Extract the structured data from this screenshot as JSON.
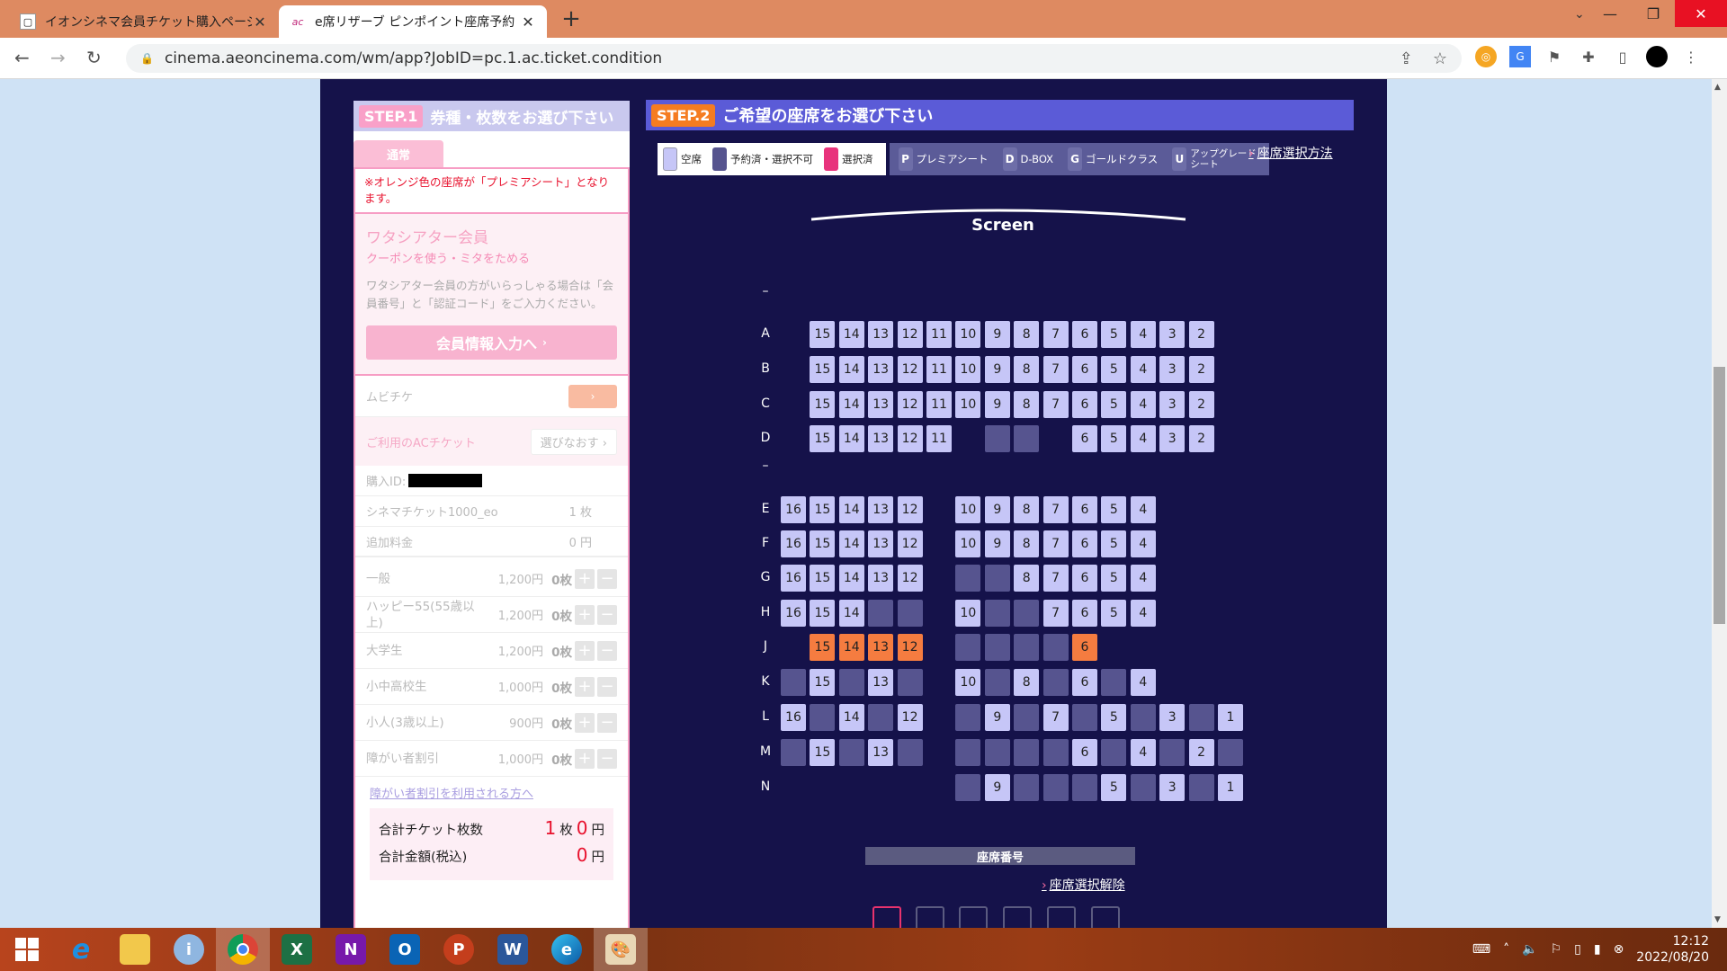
{
  "browser": {
    "tabs": [
      {
        "title": "イオンシネマ会員チケット購入ページ"
      },
      {
        "title": "e席リザーブ ピンポイント座席予約"
      }
    ],
    "url": "cinema.aeoncinema.com/wm/app?JobID=pc.1.ac.ticket.condition"
  },
  "left": {
    "step_badge": "STEP.1",
    "step_title": "券種・枚数をお選び下さい",
    "tab_label": "通常",
    "note": "※オレンジ色の座席が「プレミアシート」となります。",
    "member_title": "ワタシアター会員",
    "member_sub": "クーポンを使う・ミタをためる",
    "member_text": "ワタシアター会員の方がいらっしゃる場合は「会員番号」と「認証コード」をご入力ください。",
    "member_button": "会員情報入力へ",
    "mubichike_label": "ムビチケ",
    "ac_label": "ご利用のACチケット",
    "ac_button": "選びなおす",
    "purchase_id_label": "購入ID:",
    "cinema_ticket_label": "シネマチケット1000_eo",
    "cinema_ticket_count": "1 枚",
    "extra_fee_label": "追加料金",
    "extra_fee_value": "0 円",
    "ticket_types": [
      {
        "name": "一般",
        "price": "1,200円",
        "count": "0枚"
      },
      {
        "name": "ハッピー55(55歳以上)",
        "price": "1,200円",
        "count": "0枚"
      },
      {
        "name": "大学生",
        "price": "1,200円",
        "count": "0枚"
      },
      {
        "name": "小中高校生",
        "price": "1,000円",
        "count": "0枚"
      },
      {
        "name": "小人(3歳以上)",
        "price": "900円",
        "count": "0枚"
      },
      {
        "name": "障がい者割引",
        "price": "1,000円",
        "count": "0枚"
      }
    ],
    "disability_link": "障がい者割引を利用される方へ",
    "total_tickets_label": "合計チケット枚数",
    "total_tickets_value": "1",
    "total_tickets_unit": "枚",
    "total_tickets_yen": "0",
    "total_amount_label": "合計金額(税込)",
    "total_amount_value": "0",
    "yen": "円"
  },
  "right": {
    "step_badge": "STEP.2",
    "step_title": "ご希望の座席をお選び下さい",
    "legend": {
      "available": "空席",
      "taken": "予約済・選択不可",
      "selected": "選択済",
      "premier_letter": "P",
      "premier": "プレミアシート",
      "dbox_letter": "D",
      "dbox": "D-BOX",
      "gold_letter": "G",
      "gold": "ゴールドクラス",
      "upgrade_letter": "U",
      "upgrade": "アップグレードシート"
    },
    "howto_link": "座席選択方法",
    "screen_label": "Screen",
    "seat_number_label": "座席番号",
    "cancel_link": "座席選択解除"
  },
  "seatmap": {
    "rows": [
      {
        "label": "–",
        "seats": []
      },
      {
        "label": "A",
        "seats": [
          [
            "15",
            "a"
          ],
          [
            "14",
            "a"
          ],
          [
            "13",
            "a"
          ],
          [
            "12",
            "a"
          ],
          [
            "11",
            "a"
          ],
          [
            "10",
            "a"
          ],
          [
            "9",
            "a"
          ],
          [
            "8",
            "a"
          ],
          [
            "7",
            "a"
          ],
          [
            "6",
            "a"
          ],
          [
            "5",
            "a"
          ],
          [
            "4",
            "a"
          ],
          [
            "3",
            "a"
          ],
          [
            "2",
            "a"
          ]
        ]
      },
      {
        "label": "B",
        "seats": [
          [
            "15",
            "a"
          ],
          [
            "14",
            "a"
          ],
          [
            "13",
            "a"
          ],
          [
            "12",
            "a"
          ],
          [
            "11",
            "a"
          ],
          [
            "10",
            "a"
          ],
          [
            "9",
            "a"
          ],
          [
            "8",
            "a"
          ],
          [
            "7",
            "a"
          ],
          [
            "6",
            "a"
          ],
          [
            "5",
            "a"
          ],
          [
            "4",
            "a"
          ],
          [
            "3",
            "a"
          ],
          [
            "2",
            "a"
          ]
        ]
      },
      {
        "label": "C",
        "seats": [
          [
            "15",
            "a"
          ],
          [
            "14",
            "a"
          ],
          [
            "13",
            "a"
          ],
          [
            "12",
            "a"
          ],
          [
            "11",
            "a"
          ],
          [
            "10",
            "a"
          ],
          [
            "9",
            "a"
          ],
          [
            "8",
            "a"
          ],
          [
            "7",
            "a"
          ],
          [
            "6",
            "a"
          ],
          [
            "5",
            "a"
          ],
          [
            "4",
            "a"
          ],
          [
            "3",
            "a"
          ],
          [
            "2",
            "a"
          ]
        ]
      },
      {
        "label": "D",
        "seats": [
          [
            "15",
            "a"
          ],
          [
            "14",
            "a"
          ],
          [
            "13",
            "a"
          ],
          [
            "12",
            "a"
          ],
          [
            "11",
            "a"
          ],
          null,
          [
            "",
            "t"
          ],
          [
            "",
            "t"
          ],
          null,
          [
            "6",
            "a"
          ],
          [
            "5",
            "a"
          ],
          [
            "4",
            "a"
          ],
          [
            "3",
            "a"
          ],
          [
            "2",
            "a"
          ]
        ]
      },
      {
        "label": "–",
        "seats": []
      },
      {
        "label": "E",
        "seats": [
          [
            "16",
            "a"
          ],
          [
            "15",
            "a"
          ],
          [
            "14",
            "a"
          ],
          [
            "13",
            "a"
          ],
          [
            "12",
            "a"
          ],
          null,
          [
            "10",
            "a"
          ],
          [
            "9",
            "a"
          ],
          [
            "8",
            "a"
          ],
          [
            "7",
            "a"
          ],
          [
            "6",
            "a"
          ],
          [
            "5",
            "a"
          ],
          [
            "4",
            "a"
          ]
        ]
      },
      {
        "label": "F",
        "seats": [
          [
            "16",
            "a"
          ],
          [
            "15",
            "a"
          ],
          [
            "14",
            "a"
          ],
          [
            "13",
            "a"
          ],
          [
            "12",
            "a"
          ],
          null,
          [
            "10",
            "a"
          ],
          [
            "9",
            "a"
          ],
          [
            "8",
            "a"
          ],
          [
            "7",
            "a"
          ],
          [
            "6",
            "a"
          ],
          [
            "5",
            "a"
          ],
          [
            "4",
            "a"
          ]
        ]
      },
      {
        "label": "G",
        "seats": [
          [
            "16",
            "a"
          ],
          [
            "15",
            "a"
          ],
          [
            "14",
            "a"
          ],
          [
            "13",
            "a"
          ],
          [
            "12",
            "a"
          ],
          null,
          [
            "",
            "t"
          ],
          [
            "",
            "t"
          ],
          [
            "8",
            "a"
          ],
          [
            "7",
            "a"
          ],
          [
            "6",
            "a"
          ],
          [
            "5",
            "a"
          ],
          [
            "4",
            "a"
          ]
        ]
      },
      {
        "label": "H",
        "seats": [
          [
            "16",
            "a"
          ],
          [
            "15",
            "a"
          ],
          [
            "14",
            "a"
          ],
          [
            "",
            "t"
          ],
          [
            "",
            "t"
          ],
          null,
          [
            "10",
            "a"
          ],
          [
            "",
            "t"
          ],
          [
            "",
            "t"
          ],
          [
            "7",
            "a"
          ],
          [
            "6",
            "a"
          ],
          [
            "5",
            "a"
          ],
          [
            "4",
            "a"
          ]
        ]
      },
      {
        "label": "J",
        "seats": [
          null,
          [
            "15",
            "p"
          ],
          [
            "14",
            "p"
          ],
          [
            "13",
            "p"
          ],
          [
            "12",
            "p"
          ],
          null,
          [
            "",
            "t"
          ],
          [
            "",
            "t"
          ],
          [
            "",
            "t"
          ],
          [
            "",
            "t"
          ],
          [
            "6",
            "p"
          ]
        ]
      },
      {
        "label": "K",
        "seats": [
          [
            "",
            "t"
          ],
          [
            "15",
            "a"
          ],
          [
            "",
            "t"
          ],
          [
            "13",
            "a"
          ],
          [
            "",
            "t"
          ],
          null,
          [
            "10",
            "a"
          ],
          [
            "",
            "t"
          ],
          [
            "8",
            "a"
          ],
          [
            "",
            "t"
          ],
          [
            "6",
            "a"
          ],
          [
            "",
            "t"
          ],
          [
            "4",
            "a"
          ]
        ]
      },
      {
        "label": "L",
        "seats": [
          [
            "16",
            "a"
          ],
          [
            "",
            "t"
          ],
          [
            "14",
            "a"
          ],
          [
            "",
            "t"
          ],
          [
            "12",
            "a"
          ],
          null,
          [
            "",
            "t"
          ],
          [
            "9",
            "a"
          ],
          [
            "",
            "t"
          ],
          [
            "7",
            "a"
          ],
          [
            "",
            "t"
          ],
          [
            "5",
            "a"
          ],
          [
            "",
            "t"
          ],
          [
            "3",
            "a"
          ],
          [
            "",
            "t"
          ],
          [
            "1",
            "a"
          ]
        ]
      },
      {
        "label": "M",
        "seats": [
          [
            "",
            "t"
          ],
          [
            "15",
            "a"
          ],
          [
            "",
            "t"
          ],
          [
            "13",
            "a"
          ],
          [
            "",
            "t"
          ],
          null,
          [
            "",
            "t"
          ],
          [
            "",
            "t"
          ],
          [
            "",
            "t"
          ],
          [
            "",
            "t"
          ],
          [
            "6",
            "a"
          ],
          [
            "",
            "t"
          ],
          [
            "4",
            "a"
          ],
          [
            "",
            "t"
          ],
          [
            "2",
            "a"
          ],
          [
            "",
            "t"
          ]
        ]
      },
      {
        "label": "N",
        "seats": [
          null,
          null,
          null,
          null,
          null,
          null,
          [
            "",
            "t"
          ],
          [
            "9",
            "a"
          ],
          [
            "",
            "t"
          ],
          [
            "",
            "t"
          ],
          [
            "",
            "t"
          ],
          [
            "5",
            "a"
          ],
          [
            "",
            "t"
          ],
          [
            "3",
            "a"
          ],
          [
            "",
            "t"
          ],
          [
            "1",
            "a"
          ]
        ]
      }
    ]
  },
  "taskbar": {
    "time": "12:12",
    "date": "2022/08/20"
  }
}
